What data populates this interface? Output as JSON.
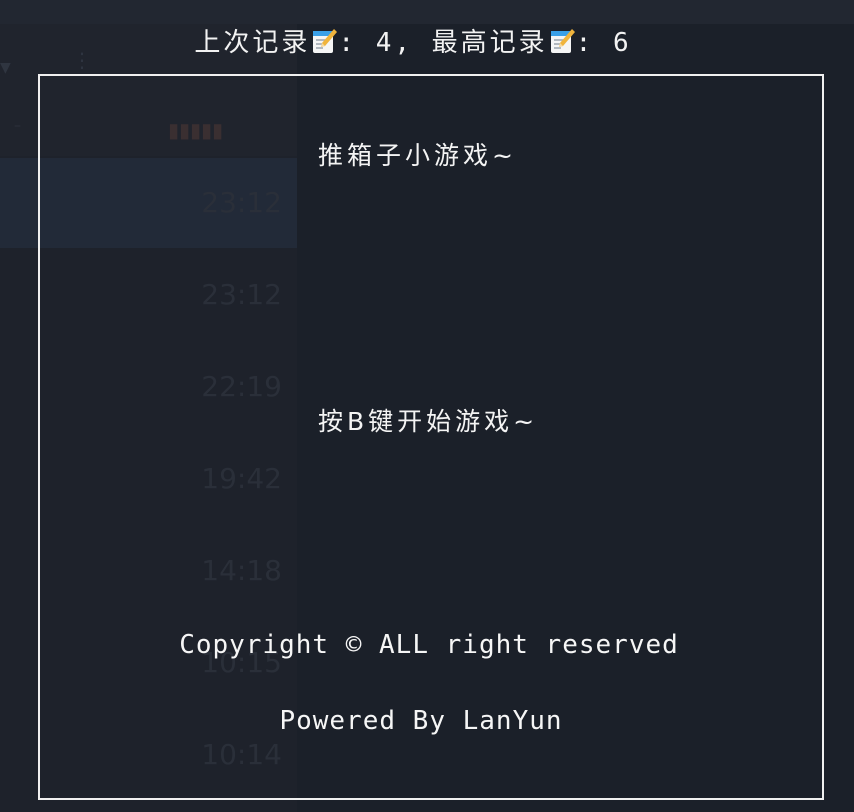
{
  "score": {
    "last_label": "上次记录",
    "last_value": "4",
    "separator": ", ",
    "best_label": "最高记录",
    "best_value": "6",
    "colon": ": ",
    "memo_icon": "memo-icon"
  },
  "game": {
    "title": "推箱子小游戏~",
    "start_hint": "按B键开始游戏~"
  },
  "footer": {
    "copyright": "Copyright © ALL right reserved",
    "powered": "Powered By LanYun"
  },
  "background": {
    "times": [
      "23:12",
      "22:19",
      "19:42",
      "14:18",
      "10:15",
      "10:14"
    ],
    "selected_time": "23:12"
  },
  "colors": {
    "background": "#1c2029",
    "text": "#f2f2f2",
    "border": "#f0f0f0"
  }
}
